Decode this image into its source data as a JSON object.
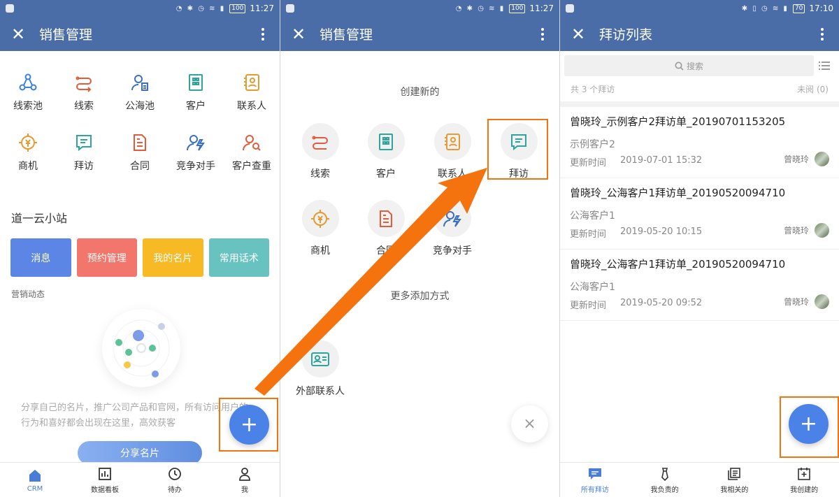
{
  "status_bars": [
    {
      "time": "11:27",
      "battery": "100"
    },
    {
      "time": "11:27",
      "battery": "100"
    },
    {
      "time": "17:10",
      "battery": "70"
    }
  ],
  "panel1": {
    "title": "销售管理",
    "grid": [
      {
        "label": "线索池",
        "icon": "leads-pool-icon",
        "color": "#3b82d6"
      },
      {
        "label": "线索",
        "icon": "leads-icon",
        "color": "#e25c3b"
      },
      {
        "label": "公海池",
        "icon": "public-pool-icon",
        "color": "#3b6fc2"
      },
      {
        "label": "客户",
        "icon": "customer-icon",
        "color": "#2ea59a"
      },
      {
        "label": "联系人",
        "icon": "contact-icon",
        "color": "#e69b2e"
      },
      {
        "label": "商机",
        "icon": "opportunity-icon",
        "color": "#e69b2e"
      },
      {
        "label": "拜访",
        "icon": "visit-icon",
        "color": "#2ea59a"
      },
      {
        "label": "合同",
        "icon": "contract-icon",
        "color": "#e25c3b"
      },
      {
        "label": "竞争对手",
        "icon": "competitor-icon",
        "color": "#3b6fc2"
      },
      {
        "label": "客户查重",
        "icon": "customer-dedupe-icon",
        "color": "#e25c3b"
      }
    ],
    "section_title": "道一云小站",
    "cards": [
      {
        "label": "消息",
        "color": "#5b86e5"
      },
      {
        "label": "预约管理",
        "color": "#f2766b"
      },
      {
        "label": "我的名片",
        "color": "#f7b924"
      },
      {
        "label": "常用话术",
        "color": "#68c3c0"
      }
    ],
    "marketing_label": "营销动态",
    "empty_text": "分享自己的名片，推广公司产品和官网，所有访问用户的行为和喜好都会出现在这里，高效获客",
    "share_button": "分享名片",
    "fab": "+",
    "tabs": [
      {
        "label": "CRM",
        "icon": "home-icon"
      },
      {
        "label": "数据看板",
        "icon": "chart-icon"
      },
      {
        "label": "待办",
        "icon": "clock-icon"
      },
      {
        "label": "我",
        "icon": "person-icon"
      }
    ]
  },
  "panel2": {
    "title": "销售管理",
    "create_title": "创建新的",
    "items": [
      {
        "label": "线索",
        "icon": "leads-icon",
        "color": "#e25c3b"
      },
      {
        "label": "客户",
        "icon": "customer-icon",
        "color": "#2ea59a"
      },
      {
        "label": "联系人",
        "icon": "contact-icon",
        "color": "#e69b2e"
      },
      {
        "label": "拜访",
        "icon": "visit-icon",
        "color": "#2ea59a"
      },
      {
        "label": "商机",
        "icon": "opportunity-icon",
        "color": "#e69b2e"
      },
      {
        "label": "合同",
        "icon": "contract-icon",
        "color": "#e25c3b"
      },
      {
        "label": "竞争对手",
        "icon": "competitor-icon",
        "color": "#3b6fc2"
      }
    ],
    "more_title": "更多添加方式",
    "external_contact": "外部联系人",
    "close_fab": "×"
  },
  "panel3": {
    "title": "拜访列表",
    "search_placeholder": "搜索",
    "count_text": "共 3 个拜访",
    "unread_text": "未阅 (0)",
    "visits": [
      {
        "title": "曾晓玲_示例客户2拜访单_20190701153205",
        "customer": "示例客户2",
        "updated_label": "更新时间",
        "updated": "2019-07-01 15:32",
        "owner": "曾晓玲"
      },
      {
        "title": "曾晓玲_公海客户1拜访单_20190520094710",
        "customer": "公海客户1",
        "updated_label": "更新时间",
        "updated": "2019-05-20 10:15",
        "owner": "曾晓玲"
      },
      {
        "title": "曾晓玲_公海客户1拜访单_20190520094710",
        "customer": "公海客户1",
        "updated_label": "更新时间",
        "updated": "2019-05-20 09:52",
        "owner": "曾晓玲"
      }
    ],
    "fab": "+",
    "tabs": [
      {
        "label": "所有拜访",
        "icon": "visit-list-icon"
      },
      {
        "label": "我负责的",
        "icon": "tie-icon"
      },
      {
        "label": "我相关的",
        "icon": "related-icon"
      },
      {
        "label": "我创建的",
        "icon": "created-icon"
      }
    ]
  },
  "annotation_color": "#f5730f"
}
